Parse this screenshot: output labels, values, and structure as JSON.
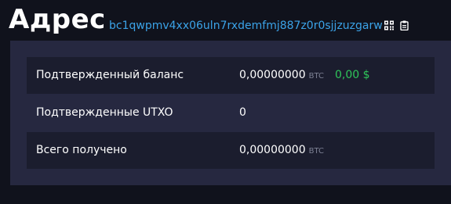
{
  "header": {
    "title": "Адрес",
    "address": "bc1qwpmv4xx06uln7rxdemfmj887z0r0sjjzuzgarw",
    "qr_icon": "qr-code-icon",
    "copy_icon": "clipboard-copy-icon"
  },
  "details": {
    "rows": [
      {
        "label": "Подтвержденный баланс",
        "value": "0,00000000",
        "unit": "BTC",
        "fiat": "0,00 $"
      },
      {
        "label": "Подтвержденные UTXO",
        "value": "0"
      },
      {
        "label": "Всего получено",
        "value": "0,00000000",
        "unit": "BTC"
      }
    ]
  },
  "colors": {
    "background": "#10121c",
    "panel": "#262840",
    "row_shaded": "#1b1d2e",
    "link": "#3ba3e8",
    "fiat": "#2fc55a",
    "muted": "#7d8194"
  }
}
